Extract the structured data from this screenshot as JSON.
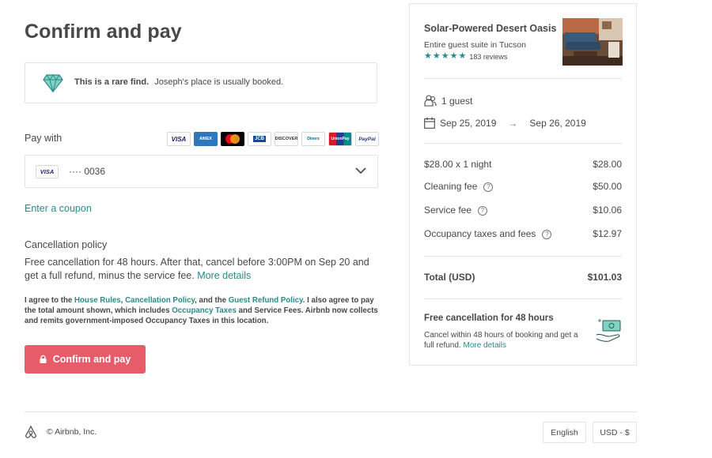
{
  "page": {
    "title": "Confirm and pay"
  },
  "rare_find": {
    "icon": "diamond-icon",
    "bold": "This is a rare find.",
    "text": "Joseph's place is usually booked."
  },
  "payment": {
    "label": "Pay with",
    "accepted_cards": [
      "VISA",
      "AMEX",
      "MC",
      "JCB",
      "DISCOVER",
      "Diners",
      "UnionPay",
      "PayPal"
    ],
    "selected_card_brand": "VISA",
    "selected_card_number": "···· 0036"
  },
  "coupon": {
    "label": "Enter a coupon"
  },
  "cancellation": {
    "heading": "Cancellation policy",
    "text": "Free cancellation for 48 hours. After that, cancel before 3:00PM on Sep 20 and get a full refund, minus the service fee.",
    "more_link": "More details"
  },
  "agreement": {
    "t1": "I agree to the ",
    "house_rules": "House Rules",
    "t2": ", ",
    "cancel_policy": "Cancellation Policy",
    "t3": ", and the ",
    "refund_policy": "Guest Refund Policy",
    "t4": ". I also agree to pay the total amount shown, which includes ",
    "occupancy_taxes": "Occupancy Taxes",
    "t5": " and Service Fees. Airbnb now collects and remits government-imposed Occupancy Taxes in this location."
  },
  "confirm_button": {
    "label": "Confirm and pay"
  },
  "summary": {
    "listing_title": "Solar-Powered Desert Oasis",
    "listing_subtitle": "Entire guest suite in Tucson",
    "rating_stars": 5,
    "reviews": "183 reviews",
    "guests": "1 guest",
    "check_in": "Sep 25, 2019",
    "check_out": "Sep 26, 2019",
    "lines": [
      {
        "label": "$28.00 x 1 night",
        "amount": "$28.00",
        "help": false
      },
      {
        "label": "Cleaning fee",
        "amount": "$50.00",
        "help": true
      },
      {
        "label": "Service fee",
        "amount": "$10.06",
        "help": true
      },
      {
        "label": "Occupancy taxes and fees",
        "amount": "$12.97",
        "help": true
      }
    ],
    "total_label": "Total (USD)",
    "total_amount": "$101.03",
    "free_cancel_title": "Free cancellation for 48 hours",
    "free_cancel_text": "Cancel within 48 hours of booking and get a full refund.",
    "free_cancel_link": "More details"
  },
  "footer": {
    "copyright": "© Airbnb, Inc.",
    "language": "English",
    "currency": "USD - $"
  },
  "colors": {
    "accent": "#e85b68",
    "link": "#2b8a8a",
    "text": "#484848",
    "border": "#e4e4e4"
  }
}
